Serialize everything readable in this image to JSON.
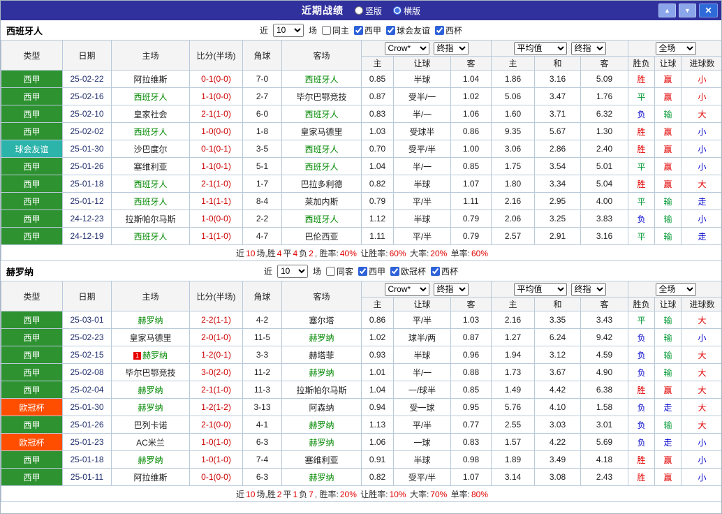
{
  "topbar": {
    "title": "近期战绩",
    "radios": [
      {
        "label": "竖版",
        "selected": false
      },
      {
        "label": "横版",
        "selected": true
      }
    ],
    "buttons": {
      "up": "▲",
      "down": "▼",
      "close": "✕"
    }
  },
  "colors": {
    "topbar_bg": "#31319E",
    "liga": "#2E9231",
    "friendly": "#2CB3AA",
    "ucl": "#FF4E00",
    "focus_team": "#008800",
    "score": "#CC0000",
    "red": "#E10000",
    "green": "#009933",
    "blue": "#0000CC"
  },
  "table": {
    "headers": {
      "type": "类型",
      "date": "日期",
      "home": "主场",
      "score": "比分(半场)",
      "corner": "角球",
      "away": "客场",
      "sub": [
        "主",
        "让球",
        "客",
        "主",
        "和",
        "客",
        "胜负",
        "让球",
        "进球数"
      ]
    }
  },
  "sections": [
    {
      "team": "西班牙人",
      "filters": {
        "near": "近",
        "count": "10",
        "games": "场",
        "same": {
          "label": "同主",
          "checked": false
        },
        "comps": [
          {
            "label": "西甲",
            "checked": true
          },
          {
            "label": "球会友谊",
            "checked": true
          },
          {
            "label": "西杯",
            "checked": true
          }
        ]
      },
      "selects": {
        "source": "Crow*",
        "source_final": "终指",
        "avg": "平均值",
        "avg_final": "终指",
        "scope": "全场"
      },
      "rows": [
        {
          "type": "西甲",
          "type_key": "liga",
          "date": "25-02-22",
          "home": "阿拉维斯",
          "home_focus": false,
          "score": "0-1(0-0)",
          "corner": "7-0",
          "away": "西班牙人",
          "away_focus": true,
          "odds": [
            "0.85",
            "半球",
            "1.04"
          ],
          "avg": [
            "1.86",
            "3.16",
            "5.09"
          ],
          "results": [
            {
              "t": "胜",
              "c": "red"
            },
            {
              "t": "赢",
              "c": "red"
            },
            {
              "t": "小",
              "c": "red"
            }
          ]
        },
        {
          "type": "西甲",
          "type_key": "liga",
          "date": "25-02-16",
          "home": "西班牙人",
          "home_focus": true,
          "score": "1-1(0-0)",
          "corner": "2-7",
          "away": "毕尔巴鄂竞技",
          "away_focus": false,
          "odds": [
            "0.87",
            "受半/一",
            "1.02"
          ],
          "avg": [
            "5.06",
            "3.47",
            "1.76"
          ],
          "results": [
            {
              "t": "平",
              "c": "green"
            },
            {
              "t": "赢",
              "c": "red"
            },
            {
              "t": "小",
              "c": "red"
            }
          ]
        },
        {
          "type": "西甲",
          "type_key": "liga",
          "date": "25-02-10",
          "home": "皇家社会",
          "home_focus": false,
          "score": "2-1(1-0)",
          "corner": "6-0",
          "away": "西班牙人",
          "away_focus": true,
          "odds": [
            "0.83",
            "半/一",
            "1.06"
          ],
          "avg": [
            "1.60",
            "3.71",
            "6.32"
          ],
          "results": [
            {
              "t": "负",
              "c": "blue"
            },
            {
              "t": "输",
              "c": "green"
            },
            {
              "t": "大",
              "c": "red"
            }
          ]
        },
        {
          "type": "西甲",
          "type_key": "liga",
          "date": "25-02-02",
          "home": "西班牙人",
          "home_focus": true,
          "score": "1-0(0-0)",
          "corner": "1-8",
          "away": "皇家马德里",
          "away_focus": false,
          "odds": [
            "1.03",
            "受球半",
            "0.86"
          ],
          "avg": [
            "9.35",
            "5.67",
            "1.30"
          ],
          "results": [
            {
              "t": "胜",
              "c": "red"
            },
            {
              "t": "赢",
              "c": "red"
            },
            {
              "t": "小",
              "c": "blue"
            }
          ]
        },
        {
          "type": "球会友谊",
          "type_key": "friendly",
          "date": "25-01-30",
          "home": "沙巴度尔",
          "home_focus": false,
          "score": "0-1(0-1)",
          "corner": "3-5",
          "away": "西班牙人",
          "away_focus": true,
          "odds": [
            "0.70",
            "受平/半",
            "1.00"
          ],
          "avg": [
            "3.06",
            "2.86",
            "2.40"
          ],
          "results": [
            {
              "t": "胜",
              "c": "red"
            },
            {
              "t": "赢",
              "c": "red"
            },
            {
              "t": "小",
              "c": "blue"
            }
          ]
        },
        {
          "type": "西甲",
          "type_key": "liga",
          "date": "25-01-26",
          "home": "塞维利亚",
          "home_focus": false,
          "score": "1-1(0-1)",
          "corner": "5-1",
          "away": "西班牙人",
          "away_focus": true,
          "odds": [
            "1.04",
            "半/一",
            "0.85"
          ],
          "avg": [
            "1.75",
            "3.54",
            "5.01"
          ],
          "results": [
            {
              "t": "平",
              "c": "green"
            },
            {
              "t": "赢",
              "c": "red"
            },
            {
              "t": "小",
              "c": "blue"
            }
          ]
        },
        {
          "type": "西甲",
          "type_key": "liga",
          "date": "25-01-18",
          "home": "西班牙人",
          "home_focus": true,
          "score": "2-1(1-0)",
          "corner": "1-7",
          "away": "巴拉多利德",
          "away_focus": false,
          "odds": [
            "0.82",
            "半球",
            "1.07"
          ],
          "avg": [
            "1.80",
            "3.34",
            "5.04"
          ],
          "results": [
            {
              "t": "胜",
              "c": "red"
            },
            {
              "t": "赢",
              "c": "red"
            },
            {
              "t": "大",
              "c": "red"
            }
          ]
        },
        {
          "type": "西甲",
          "type_key": "liga",
          "date": "25-01-12",
          "home": "西班牙人",
          "home_focus": true,
          "score": "1-1(1-1)",
          "corner": "8-4",
          "away": "莱加内斯",
          "away_focus": false,
          "odds": [
            "0.79",
            "平/半",
            "1.11"
          ],
          "avg": [
            "2.16",
            "2.95",
            "4.00"
          ],
          "results": [
            {
              "t": "平",
              "c": "green"
            },
            {
              "t": "输",
              "c": "green"
            },
            {
              "t": "走",
              "c": "blue"
            }
          ]
        },
        {
          "type": "西甲",
          "type_key": "liga",
          "date": "24-12-23",
          "home": "拉斯帕尔马斯",
          "home_focus": false,
          "score": "1-0(0-0)",
          "corner": "2-2",
          "away": "西班牙人",
          "away_focus": true,
          "odds": [
            "1.12",
            "半球",
            "0.79"
          ],
          "avg": [
            "2.06",
            "3.25",
            "3.83"
          ],
          "results": [
            {
              "t": "负",
              "c": "blue"
            },
            {
              "t": "输",
              "c": "green"
            },
            {
              "t": "小",
              "c": "blue"
            }
          ]
        },
        {
          "type": "西甲",
          "type_key": "liga",
          "date": "24-12-19",
          "home": "西班牙人",
          "home_focus": true,
          "score": "1-1(1-0)",
          "corner": "4-7",
          "away": "巴伦西亚",
          "away_focus": false,
          "odds": [
            "1.11",
            "平/半",
            "0.79"
          ],
          "avg": [
            "2.57",
            "2.91",
            "3.16"
          ],
          "results": [
            {
              "t": "平",
              "c": "green"
            },
            {
              "t": "输",
              "c": "green"
            },
            {
              "t": "走",
              "c": "blue"
            }
          ]
        }
      ],
      "summary": [
        {
          "t": "近",
          "c": "k"
        },
        {
          "t": "10",
          "c": "r"
        },
        {
          "t": "场,胜",
          "c": "k"
        },
        {
          "t": "4",
          "c": "r"
        },
        {
          "t": "平",
          "c": "k"
        },
        {
          "t": "4",
          "c": "r"
        },
        {
          "t": "负",
          "c": "k"
        },
        {
          "t": "2",
          "c": "r"
        },
        {
          "t": ", 胜率:",
          "c": "k"
        },
        {
          "t": "40%",
          "c": "r"
        },
        {
          "t": " 让胜率:",
          "c": "k"
        },
        {
          "t": "60%",
          "c": "r"
        },
        {
          "t": " 大率:",
          "c": "k"
        },
        {
          "t": "20%",
          "c": "r"
        },
        {
          "t": " 单率:",
          "c": "k"
        },
        {
          "t": "60%",
          "c": "r"
        }
      ]
    },
    {
      "team": "赫罗纳",
      "filters": {
        "near": "近",
        "count": "10",
        "games": "场",
        "same": {
          "label": "同客",
          "checked": false
        },
        "comps": [
          {
            "label": "西甲",
            "checked": true
          },
          {
            "label": "欧冠杯",
            "checked": true
          },
          {
            "label": "西杯",
            "checked": true
          }
        ]
      },
      "selects": {
        "source": "Crow*",
        "source_final": "终指",
        "avg": "平均值",
        "avg_final": "终指",
        "scope": "全场"
      },
      "rows": [
        {
          "type": "西甲",
          "type_key": "liga",
          "date": "25-03-01",
          "home": "赫罗纳",
          "home_focus": true,
          "score": "2-2(1-1)",
          "corner": "4-2",
          "away": "塞尔塔",
          "away_focus": false,
          "odds": [
            "0.86",
            "平/半",
            "1.03"
          ],
          "avg": [
            "2.16",
            "3.35",
            "3.43"
          ],
          "results": [
            {
              "t": "平",
              "c": "green"
            },
            {
              "t": "输",
              "c": "green"
            },
            {
              "t": "大",
              "c": "red"
            }
          ]
        },
        {
          "type": "西甲",
          "type_key": "liga",
          "date": "25-02-23",
          "home": "皇家马德里",
          "home_focus": false,
          "score": "2-0(1-0)",
          "corner": "11-5",
          "away": "赫罗纳",
          "away_focus": true,
          "odds": [
            "1.02",
            "球半/两",
            "0.87"
          ],
          "avg": [
            "1.27",
            "6.24",
            "9.42"
          ],
          "results": [
            {
              "t": "负",
              "c": "blue"
            },
            {
              "t": "输",
              "c": "green"
            },
            {
              "t": "小",
              "c": "blue"
            }
          ]
        },
        {
          "type": "西甲",
          "type_key": "liga",
          "date": "25-02-15",
          "home": "赫罗纳",
          "home_focus": true,
          "home_badge": "1",
          "score": "1-2(0-1)",
          "corner": "3-3",
          "away": "赫塔菲",
          "away_focus": false,
          "odds": [
            "0.93",
            "半球",
            "0.96"
          ],
          "avg": [
            "1.94",
            "3.12",
            "4.59"
          ],
          "results": [
            {
              "t": "负",
              "c": "blue"
            },
            {
              "t": "输",
              "c": "green"
            },
            {
              "t": "大",
              "c": "red"
            }
          ]
        },
        {
          "type": "西甲",
          "type_key": "liga",
          "date": "25-02-08",
          "home": "毕尔巴鄂竞技",
          "home_focus": false,
          "score": "3-0(2-0)",
          "corner": "11-2",
          "away": "赫罗纳",
          "away_focus": true,
          "odds": [
            "1.01",
            "半/一",
            "0.88"
          ],
          "avg": [
            "1.73",
            "3.67",
            "4.90"
          ],
          "results": [
            {
              "t": "负",
              "c": "blue"
            },
            {
              "t": "输",
              "c": "green"
            },
            {
              "t": "大",
              "c": "red"
            }
          ]
        },
        {
          "type": "西甲",
          "type_key": "liga",
          "date": "25-02-04",
          "home": "赫罗纳",
          "home_focus": true,
          "score": "2-1(1-0)",
          "corner": "11-3",
          "away": "拉斯帕尔马斯",
          "away_focus": false,
          "odds": [
            "1.04",
            "一/球半",
            "0.85"
          ],
          "avg": [
            "1.49",
            "4.42",
            "6.38"
          ],
          "results": [
            {
              "t": "胜",
              "c": "red"
            },
            {
              "t": "赢",
              "c": "red"
            },
            {
              "t": "大",
              "c": "red"
            }
          ]
        },
        {
          "type": "欧冠杯",
          "type_key": "ucl",
          "date": "25-01-30",
          "home": "赫罗纳",
          "home_focus": true,
          "score": "1-2(1-2)",
          "corner": "3-13",
          "away": "阿森纳",
          "away_focus": false,
          "odds": [
            "0.94",
            "受一球",
            "0.95"
          ],
          "avg": [
            "5.76",
            "4.10",
            "1.58"
          ],
          "results": [
            {
              "t": "负",
              "c": "blue"
            },
            {
              "t": "走",
              "c": "blue"
            },
            {
              "t": "大",
              "c": "red"
            }
          ]
        },
        {
          "type": "西甲",
          "type_key": "liga",
          "date": "25-01-26",
          "home": "巴列卡诺",
          "home_focus": false,
          "score": "2-1(0-0)",
          "corner": "4-1",
          "away": "赫罗纳",
          "away_focus": true,
          "odds": [
            "1.13",
            "平/半",
            "0.77"
          ],
          "avg": [
            "2.55",
            "3.03",
            "3.01"
          ],
          "results": [
            {
              "t": "负",
              "c": "blue"
            },
            {
              "t": "输",
              "c": "green"
            },
            {
              "t": "大",
              "c": "red"
            }
          ]
        },
        {
          "type": "欧冠杯",
          "type_key": "ucl",
          "date": "25-01-23",
          "home": "AC米兰",
          "home_focus": false,
          "score": "1-0(1-0)",
          "corner": "6-3",
          "away": "赫罗纳",
          "away_focus": true,
          "odds": [
            "1.06",
            "一球",
            "0.83"
          ],
          "avg": [
            "1.57",
            "4.22",
            "5.69"
          ],
          "results": [
            {
              "t": "负",
              "c": "blue"
            },
            {
              "t": "走",
              "c": "blue"
            },
            {
              "t": "小",
              "c": "blue"
            }
          ]
        },
        {
          "type": "西甲",
          "type_key": "liga",
          "date": "25-01-18",
          "home": "赫罗纳",
          "home_focus": true,
          "score": "1-0(1-0)",
          "corner": "7-4",
          "away": "塞维利亚",
          "away_focus": false,
          "odds": [
            "0.91",
            "半球",
            "0.98"
          ],
          "avg": [
            "1.89",
            "3.49",
            "4.18"
          ],
          "results": [
            {
              "t": "胜",
              "c": "red"
            },
            {
              "t": "赢",
              "c": "red"
            },
            {
              "t": "小",
              "c": "blue"
            }
          ]
        },
        {
          "type": "西甲",
          "type_key": "liga",
          "date": "25-01-11",
          "home": "阿拉维斯",
          "home_focus": false,
          "score": "0-1(0-0)",
          "corner": "6-3",
          "away": "赫罗纳",
          "away_focus": true,
          "odds": [
            "0.82",
            "受平/半",
            "1.07"
          ],
          "avg": [
            "3.14",
            "3.08",
            "2.43"
          ],
          "results": [
            {
              "t": "胜",
              "c": "red"
            },
            {
              "t": "赢",
              "c": "red"
            },
            {
              "t": "小",
              "c": "blue"
            }
          ]
        }
      ],
      "summary": [
        {
          "t": "近",
          "c": "k"
        },
        {
          "t": "10",
          "c": "r"
        },
        {
          "t": "场,胜",
          "c": "k"
        },
        {
          "t": "2",
          "c": "r"
        },
        {
          "t": "平",
          "c": "k"
        },
        {
          "t": "1",
          "c": "r"
        },
        {
          "t": "负",
          "c": "k"
        },
        {
          "t": "7",
          "c": "r"
        },
        {
          "t": ", 胜率:",
          "c": "k"
        },
        {
          "t": "20%",
          "c": "r"
        },
        {
          "t": " 让胜率:",
          "c": "k"
        },
        {
          "t": "10%",
          "c": "r"
        },
        {
          "t": " 大率:",
          "c": "k"
        },
        {
          "t": "70%",
          "c": "r"
        },
        {
          "t": " 单率:",
          "c": "k"
        },
        {
          "t": "80%",
          "c": "r"
        }
      ]
    }
  ]
}
